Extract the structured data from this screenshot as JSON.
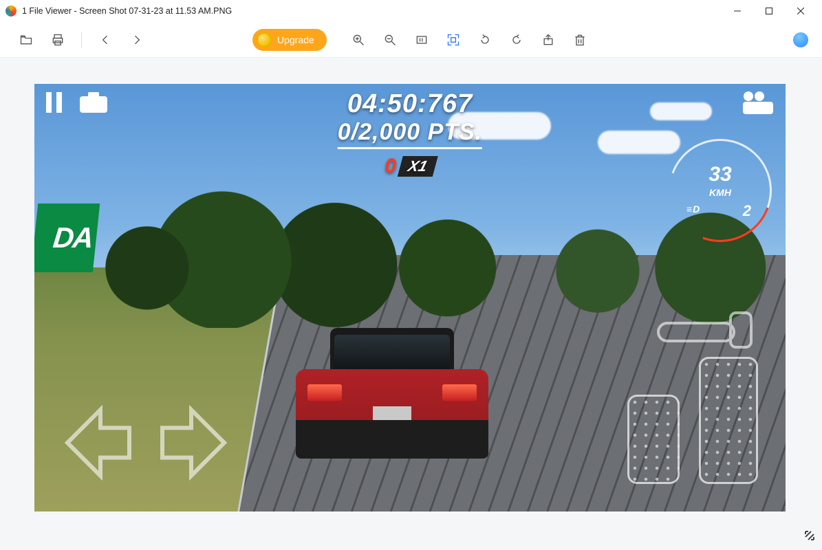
{
  "window": {
    "title": "1 File Viewer - Screen Shot 07-31-23 at 11.53 AM.PNG"
  },
  "toolbar": {
    "upgrade_label": "Upgrade"
  },
  "game_hud": {
    "timer": "04:50:767",
    "points": "0/2,000 PTS.",
    "multiplier_zero": "0",
    "multiplier_x": "X1",
    "speed_value": "33",
    "speed_unit": "KMH",
    "gear": "2",
    "headlight_icon": "≡D",
    "banner_text": "DA"
  }
}
